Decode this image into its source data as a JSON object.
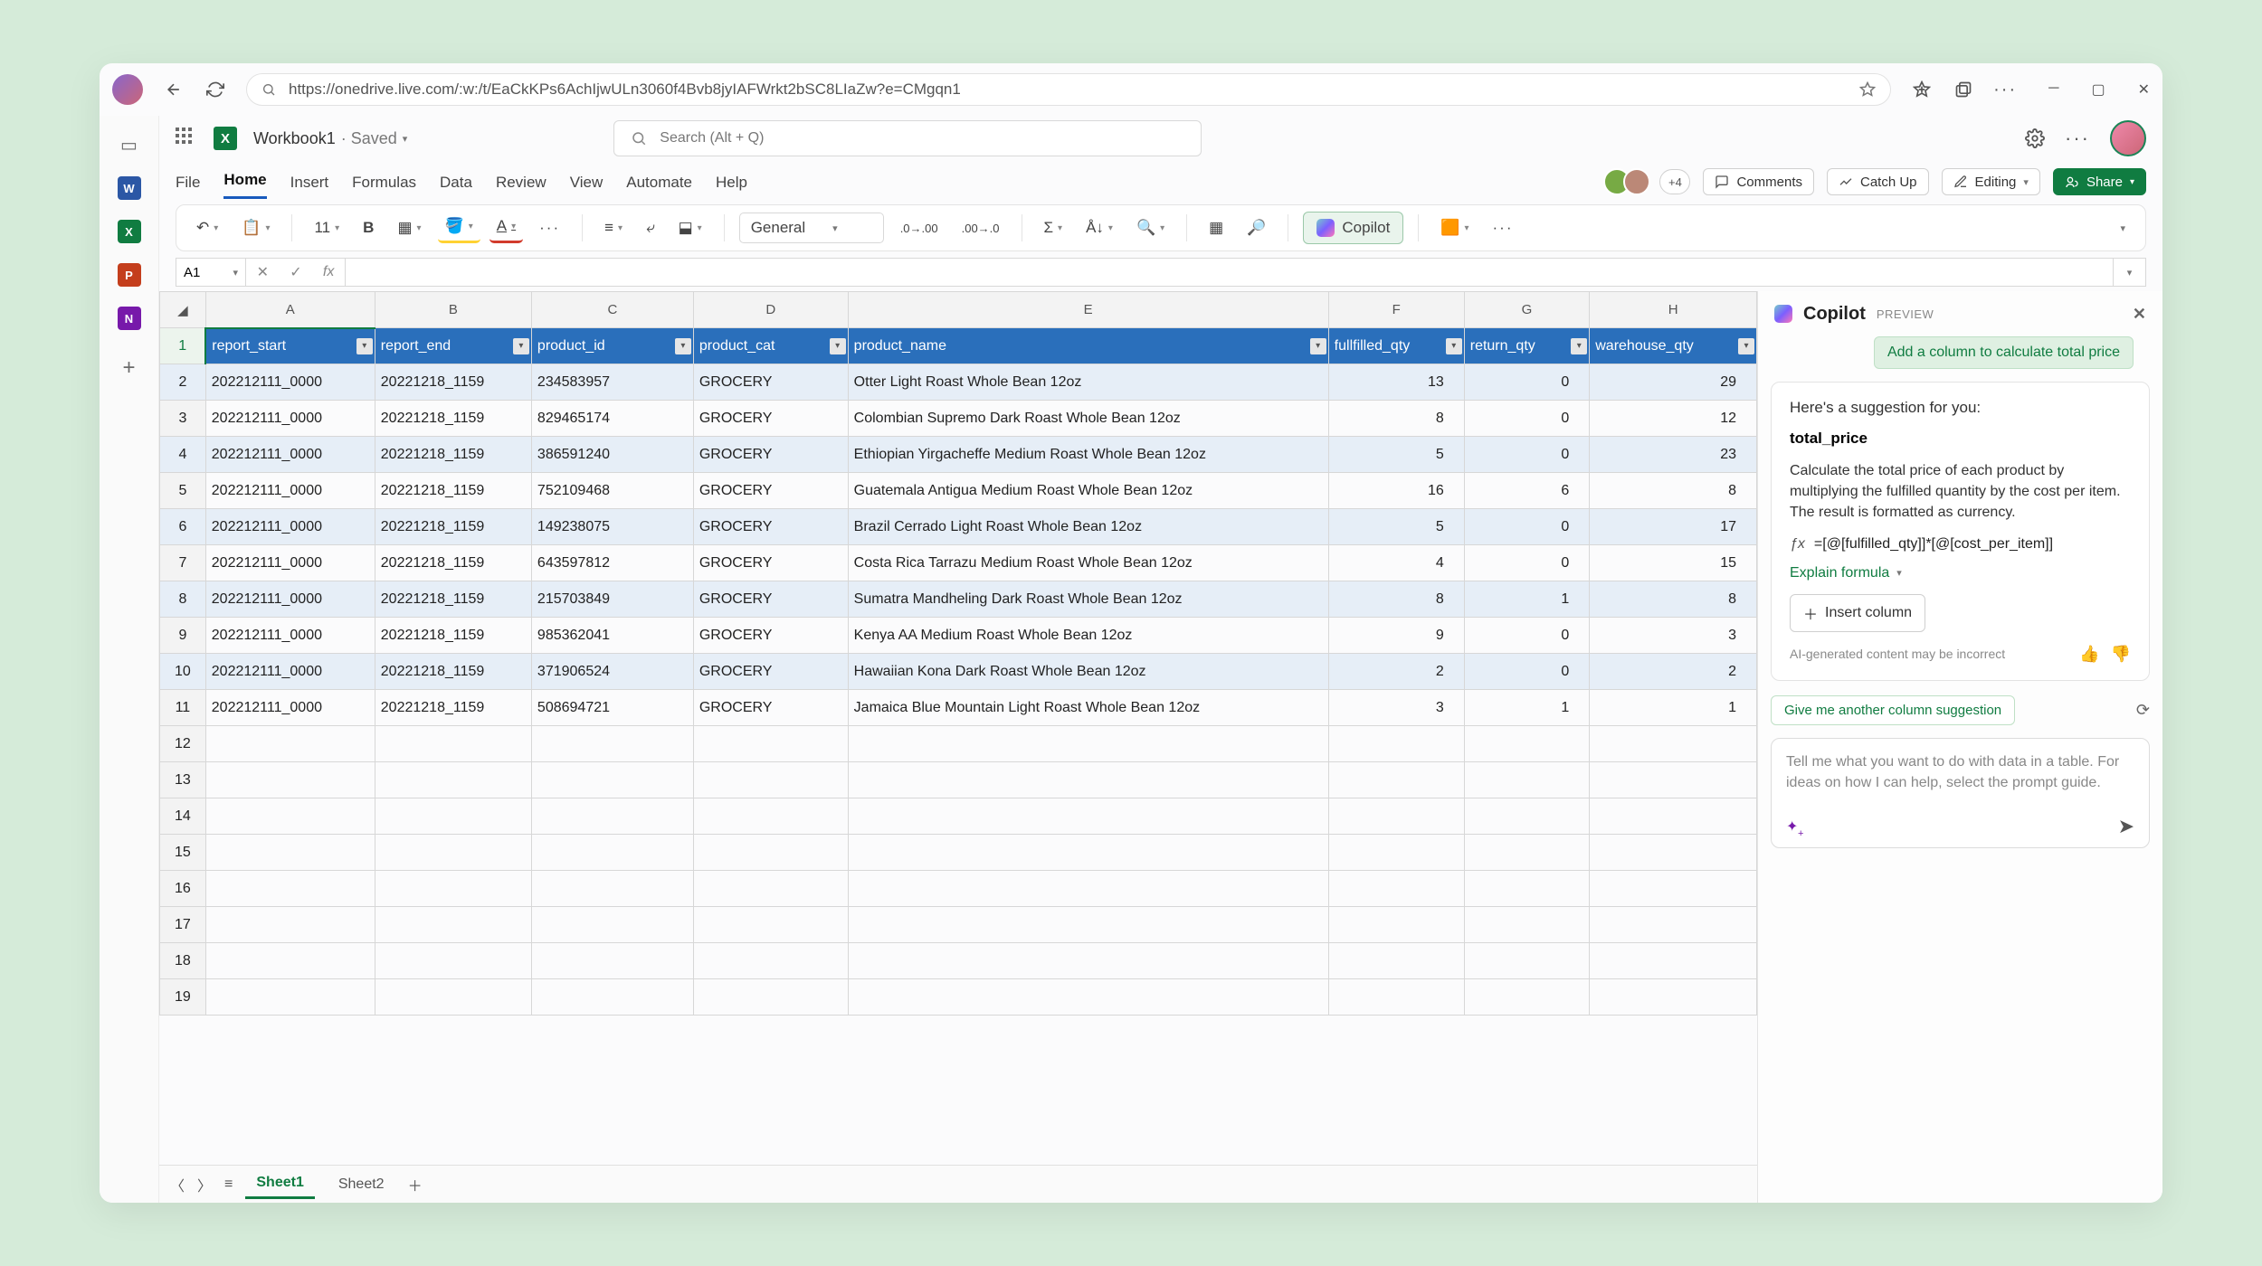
{
  "browser": {
    "url": "https://onedrive.live.com/:w:/t/EaCkKPs6AchIjwULn3060f4Bvb8jyIAFWrkt2bSC8LIaZw?e=CMgqn1"
  },
  "doc": {
    "name": "Workbook1",
    "status": "· Saved",
    "search_placeholder": "Search (Alt + Q)"
  },
  "ribbon": {
    "tabs": [
      "File",
      "Home",
      "Insert",
      "Formulas",
      "Data",
      "Review",
      "View",
      "Automate",
      "Help"
    ],
    "active": "Home",
    "comments": "Comments",
    "catchup": "Catch Up",
    "editing": "Editing",
    "share": "Share",
    "face_extra": "+4"
  },
  "toolbar": {
    "font_size": "11",
    "number_format": "General",
    "copilot": "Copilot"
  },
  "name_box": "A1",
  "columns": [
    "A",
    "B",
    "C",
    "D",
    "E",
    "F",
    "G",
    "H"
  ],
  "headers": [
    "report_start",
    "report_end",
    "product_id",
    "product_cat",
    "product_name",
    "fullfilled_qty",
    "return_qty",
    "warehouse_qty"
  ],
  "rows": [
    {
      "n": 2,
      "a": "202212111_0000",
      "b": "20221218_1159",
      "c": "234583957",
      "d": "GROCERY",
      "e": "Otter Light Roast Whole Bean 12oz",
      "f": "13",
      "g": "0",
      "h": "29"
    },
    {
      "n": 3,
      "a": "202212111_0000",
      "b": "20221218_1159",
      "c": "829465174",
      "d": "GROCERY",
      "e": "Colombian Supremo Dark Roast Whole Bean 12oz",
      "f": "8",
      "g": "0",
      "h": "12"
    },
    {
      "n": 4,
      "a": "202212111_0000",
      "b": "20221218_1159",
      "c": "386591240",
      "d": "GROCERY",
      "e": "Ethiopian Yirgacheffe Medium Roast Whole Bean 12oz",
      "f": "5",
      "g": "0",
      "h": "23"
    },
    {
      "n": 5,
      "a": "202212111_0000",
      "b": "20221218_1159",
      "c": "752109468",
      "d": "GROCERY",
      "e": "Guatemala Antigua Medium Roast Whole Bean 12oz",
      "f": "16",
      "g": "6",
      "h": "8"
    },
    {
      "n": 6,
      "a": "202212111_0000",
      "b": "20221218_1159",
      "c": "149238075",
      "d": "GROCERY",
      "e": "Brazil Cerrado Light Roast Whole Bean 12oz",
      "f": "5",
      "g": "0",
      "h": "17"
    },
    {
      "n": 7,
      "a": "202212111_0000",
      "b": "20221218_1159",
      "c": "643597812",
      "d": "GROCERY",
      "e": "Costa Rica Tarrazu Medium Roast Whole Bean 12oz",
      "f": "4",
      "g": "0",
      "h": "15"
    },
    {
      "n": 8,
      "a": "202212111_0000",
      "b": "20221218_1159",
      "c": "215703849",
      "d": "GROCERY",
      "e": "Sumatra Mandheling Dark Roast Whole Bean 12oz",
      "f": "8",
      "g": "1",
      "h": "8"
    },
    {
      "n": 9,
      "a": "202212111_0000",
      "b": "20221218_1159",
      "c": "985362041",
      "d": "GROCERY",
      "e": "Kenya AA Medium Roast Whole Bean 12oz",
      "f": "9",
      "g": "0",
      "h": "3"
    },
    {
      "n": 10,
      "a": "202212111_0000",
      "b": "20221218_1159",
      "c": "371906524",
      "d": "GROCERY",
      "e": "Hawaiian Kona Dark Roast Whole Bean 12oz",
      "f": "2",
      "g": "0",
      "h": "2"
    },
    {
      "n": 11,
      "a": "202212111_0000",
      "b": "20221218_1159",
      "c": "508694721",
      "d": "GROCERY",
      "e": "Jamaica Blue Mountain Light Roast Whole Bean 12oz",
      "f": "3",
      "g": "1",
      "h": "1"
    }
  ],
  "empty_rows": [
    12,
    13,
    14,
    15,
    16,
    17,
    18,
    19
  ],
  "sheets": {
    "tabs": [
      "Sheet1",
      "Sheet2"
    ],
    "active": "Sheet1"
  },
  "copilot": {
    "title": "Copilot",
    "preview": "PREVIEW",
    "user_chip": "Add a column to calculate total price",
    "sugg_intro": "Here's a suggestion for you:",
    "col_name": "total_price",
    "desc": "Calculate the total price of each product by multiplying the fulfilled quantity by the cost per item. The result is formatted as currency.",
    "formula": "=[@[fulfilled_qty]]*[@[cost_per_item]]",
    "explain": "Explain formula",
    "insert": "Insert column",
    "disclaimer": "AI-generated content may be incorrect",
    "another": "Give me another column suggestion",
    "prompt_placeholder": "Tell me what you want to do with data in a table. For ideas on how I can help, select the prompt guide."
  }
}
